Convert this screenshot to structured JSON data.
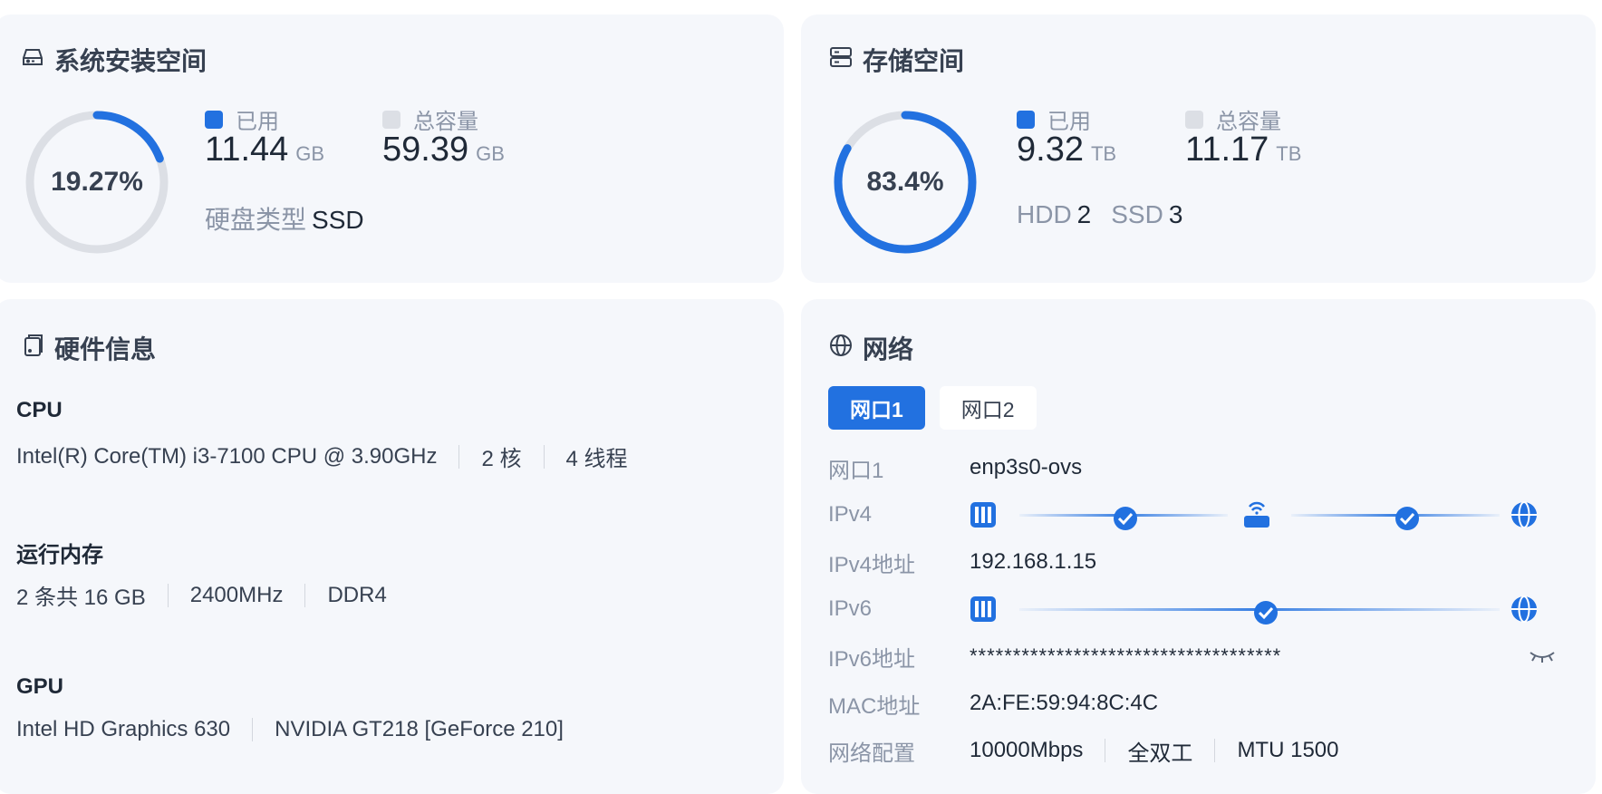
{
  "system_disk": {
    "title": "系统安装空间",
    "percent": "19.27%",
    "used_fraction": 0.1927,
    "used_label": "已用",
    "used_value": "11.44",
    "used_unit": "GB",
    "total_label": "总容量",
    "total_value": "59.39",
    "total_unit": "GB",
    "disk_type_label": "硬盘类型",
    "disk_type_value": "SSD"
  },
  "storage": {
    "title": "存储空间",
    "percent": "83.4%",
    "used_fraction": 0.834,
    "used_label": "已用",
    "used_value": "9.32",
    "used_unit": "TB",
    "total_label": "总容量",
    "total_value": "11.17",
    "total_unit": "TB",
    "hdd_label": "HDD",
    "hdd_count": "2",
    "ssd_label": "SSD",
    "ssd_count": "3"
  },
  "hardware": {
    "title": "硬件信息",
    "cpu_label": "CPU",
    "cpu_model": "Intel(R) Core(TM) i3-7100 CPU @ 3.90GHz",
    "cpu_cores": "2 核",
    "cpu_threads": "4 线程",
    "memory_label": "运行内存",
    "memory_count": "2 条共 16 GB",
    "memory_freq": "2400MHz",
    "memory_type": "DDR4",
    "gpu_label": "GPU",
    "gpu_1": "Intel HD Graphics 630",
    "gpu_2": "NVIDIA GT218 [GeForce 210]"
  },
  "network": {
    "title": "网络",
    "tabs": [
      {
        "label": "网口1",
        "active": true
      },
      {
        "label": "网口2",
        "active": false
      }
    ],
    "port_label": "网口1",
    "port_value": "enp3s0-ovs",
    "ipv4_label": "IPv4",
    "ipv4_addr_label": "IPv4地址",
    "ipv4_addr_value": "192.168.1.15",
    "ipv6_label": "IPv6",
    "ipv6_addr_label": "IPv6地址",
    "ipv6_addr_value": "************************************",
    "mac_label": "MAC地址",
    "mac_value": "2A:FE:59:94:8C:4C",
    "config_label": "网络配置",
    "config_speed": "10000Mbps",
    "config_duplex": "全双工",
    "config_mtu": "MTU 1500"
  },
  "colors": {
    "accent": "#2271e0",
    "card_bg": "#f5f7fb",
    "ring_track": "#dcdfe5",
    "muted_text": "#8b95a7"
  },
  "icons": [
    "hard-drive-icon",
    "server-icon",
    "device-icon",
    "globe-icon",
    "server-rack-icon",
    "router-icon",
    "check-circle-icon",
    "eye-closed-icon"
  ]
}
